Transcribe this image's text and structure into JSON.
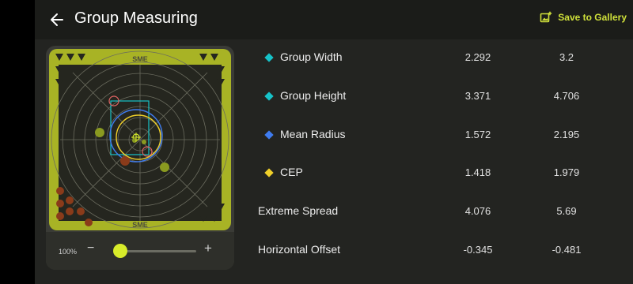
{
  "header": {
    "title": "Group Measuring",
    "save_label": "Save to Gallery"
  },
  "target": {
    "brand": "SME",
    "zoom_label": "100%",
    "zoom_value": 0.08
  },
  "stats": [
    {
      "name": "Group Width",
      "marker_color": "#16c3c9",
      "value1": "2.292",
      "value2": "3.2"
    },
    {
      "name": "Group Height",
      "marker_color": "#16c3c9",
      "value1": "3.371",
      "value2": "4.706"
    },
    {
      "name": "Mean Radius",
      "marker_color": "#3f7cf0",
      "value1": "1.572",
      "value2": "2.195"
    },
    {
      "name": "CEP",
      "marker_color": "#f0d02a",
      "value1": "1.418",
      "value2": "1.979"
    },
    {
      "name": "Extreme Spread",
      "marker_color": "",
      "value1": "4.076",
      "value2": "5.69"
    },
    {
      "name": "Horizontal Offset",
      "marker_color": "",
      "value1": "-0.345",
      "value2": "-0.481"
    }
  ],
  "colors": {
    "accent": "#d8ec2a",
    "target_yellow": "#a8b325",
    "panel": "#232421"
  }
}
